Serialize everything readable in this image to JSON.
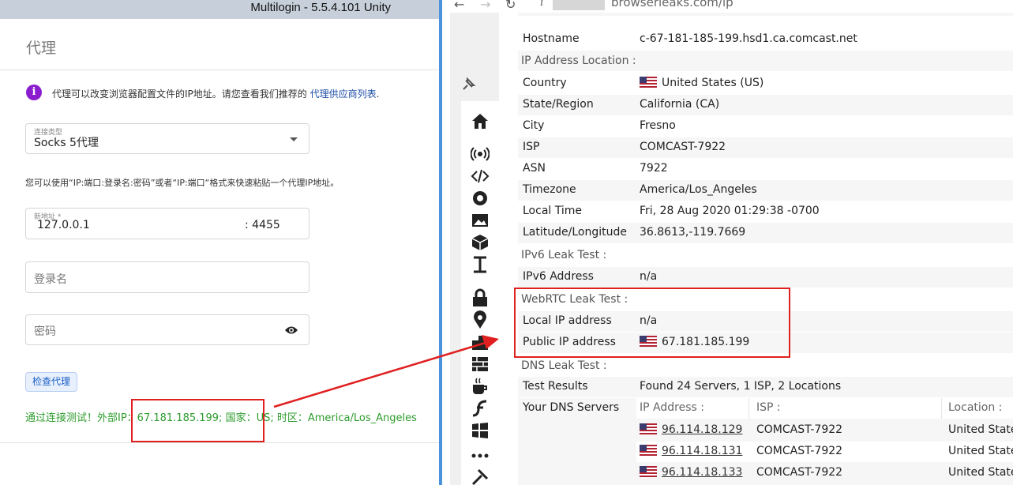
{
  "app": {
    "title": "Multilogin - 5.5.4.101 Unity"
  },
  "proxy_panel": {
    "heading": "代理",
    "info_text": "代理可以改变浏览器配置文件的IP地址。请您查看我们推荐的 ",
    "info_link": "代理供应商列表",
    "info_end": ".",
    "connection_type_label": "连接类型",
    "connection_type_value": "Socks 5代理",
    "hint": "您可以使用“IP:端口:登录名:密码”或者“IP:端口“格式来快速粘贴一个代理IP地址。",
    "new_address_label": "新地址 *",
    "ip": "127.0.0.1",
    "port": ": 4455",
    "login_placeholder": "登录名",
    "password_placeholder": "密码",
    "check_button": "检查代理",
    "result": "通过连接测试！外部IP：67.181.185.199; 国家：US; 时区：America/Los_Angeles"
  },
  "browser": {
    "url": "browserleaks.com/ip",
    "rows": {
      "hostname": {
        "key": "Hostname",
        "value": "c-67-181-185-199.hsd1.ca.comcast.net"
      },
      "location_title": "IP Address Location :",
      "country": {
        "key": "Country",
        "value": "United States (US)"
      },
      "state": {
        "key": "State/Region",
        "value": "California (CA)"
      },
      "city": {
        "key": "City",
        "value": "Fresno"
      },
      "isp": {
        "key": "ISP",
        "value": "COMCAST-7922"
      },
      "asn": {
        "key": "ASN",
        "value": "7922"
      },
      "timezone": {
        "key": "Timezone",
        "value": "America/Los_Angeles"
      },
      "localtime": {
        "key": "Local Time",
        "value": "Fri, 28 Aug 2020 01:29:38 -0700"
      },
      "latlon": {
        "key": "Latitude/Longitude",
        "value": "36.8613,-119.7669"
      },
      "ipv6_title": "IPv6 Leak Test :",
      "ipv6": {
        "key": "IPv6 Address",
        "value": "n/a"
      },
      "webrtc_title": "WebRTC Leak Test :",
      "local_ip": {
        "key": "Local IP address",
        "value": "n/a"
      },
      "public_ip": {
        "key": "Public IP address",
        "value": "67.181.185.199"
      },
      "dns_title": "DNS Leak Test :",
      "test_results": {
        "key": "Test Results",
        "value": "Found 24 Servers, 1 ISP, 2 Locations"
      },
      "dns_servers": {
        "key": "Your DNS Servers"
      }
    },
    "dns_table": {
      "headers": [
        "IP Address :",
        "ISP :",
        "Location :"
      ],
      "rows": [
        {
          "ip": "96.114.18.129",
          "isp": "COMCAST-7922",
          "location": "United States"
        },
        {
          "ip": "96.114.18.131",
          "isp": "COMCAST-7922",
          "location": "United States"
        },
        {
          "ip": "96.114.18.133",
          "isp": "COMCAST-7922",
          "location": "United States"
        }
      ]
    }
  },
  "colors": {
    "accent_blue": "#4a92dc",
    "info_purple": "#8a1ecf",
    "success_green": "#2d9c2d",
    "annotation_red": "#e02020"
  }
}
